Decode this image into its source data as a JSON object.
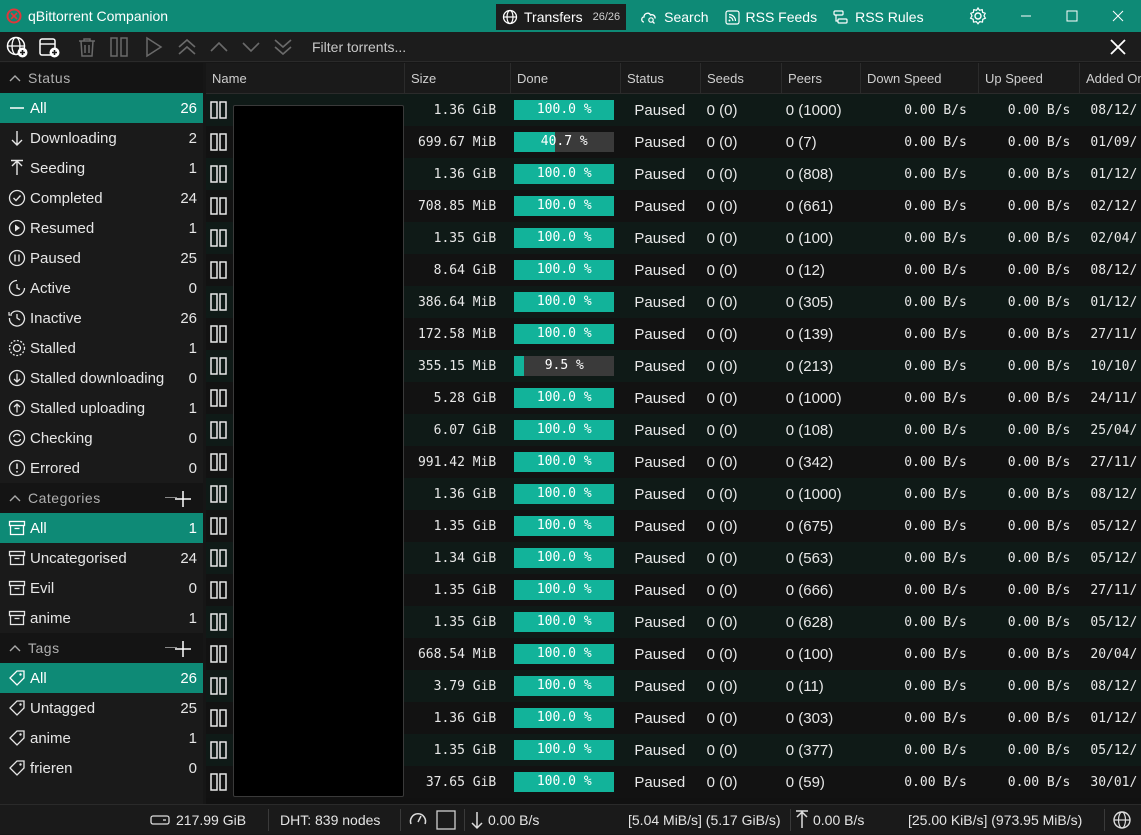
{
  "window": {
    "title": "qBittorrent Companion"
  },
  "nav": {
    "transfers": {
      "label": "Transfers",
      "count": "26/26"
    },
    "search": {
      "label": "Search"
    },
    "rss_feeds": {
      "label": "RSS Feeds"
    },
    "rss_rules": {
      "label": "RSS Rules"
    }
  },
  "toolbar": {
    "filter_placeholder": "Filter torrents..."
  },
  "sidebar": {
    "status_header": "Status",
    "status": [
      {
        "label": "All",
        "count": "26",
        "icon": "line-icon"
      },
      {
        "label": "Downloading",
        "count": "2",
        "icon": "arrow-down-icon"
      },
      {
        "label": "Seeding",
        "count": "1",
        "icon": "arrow-up-icon"
      },
      {
        "label": "Completed",
        "count": "24",
        "icon": "check-circle-icon"
      },
      {
        "label": "Resumed",
        "count": "1",
        "icon": "play-circle-icon"
      },
      {
        "label": "Paused",
        "count": "25",
        "icon": "pause-circle-icon"
      },
      {
        "label": "Active",
        "count": "0",
        "icon": "clock-icon"
      },
      {
        "label": "Inactive",
        "count": "26",
        "icon": "history-icon"
      },
      {
        "label": "Stalled",
        "count": "1",
        "icon": "stalled-icon"
      },
      {
        "label": "Stalled downloading",
        "count": "0",
        "icon": "arrow-down-circle-icon"
      },
      {
        "label": "Stalled uploading",
        "count": "1",
        "icon": "arrow-up-circle-icon"
      },
      {
        "label": "Checking",
        "count": "0",
        "icon": "refresh-circle-icon"
      },
      {
        "label": "Errored",
        "count": "0",
        "icon": "error-circle-icon"
      }
    ],
    "categories_header": "Categories",
    "categories": [
      {
        "label": "All",
        "count": "1"
      },
      {
        "label": "Uncategorised",
        "count": "24"
      },
      {
        "label": "Evil",
        "count": "0"
      },
      {
        "label": "anime",
        "count": "1"
      }
    ],
    "tags_header": "Tags",
    "tags": [
      {
        "label": "All",
        "count": "26"
      },
      {
        "label": "Untagged",
        "count": "25"
      },
      {
        "label": "anime",
        "count": "1"
      },
      {
        "label": "frieren",
        "count": "0"
      }
    ]
  },
  "table": {
    "columns": [
      "Name",
      "Size",
      "Done",
      "Status",
      "Seeds",
      "Peers",
      "Down Speed",
      "Up Speed",
      "Added On"
    ],
    "rows": [
      {
        "size": "1.36 GiB",
        "done": "100.0 %",
        "progress": 100,
        "status": "Paused",
        "seeds": "0 (0)",
        "peers": "0 (1000)",
        "down": "0.00 B/s",
        "up": "0.00 B/s",
        "added": "08/12/"
      },
      {
        "size": "699.67 MiB",
        "done": "40.7 %",
        "progress": 40.7,
        "status": "Paused",
        "seeds": "0 (0)",
        "peers": "0 (7)",
        "down": "0.00 B/s",
        "up": "0.00 B/s",
        "added": "01/09/"
      },
      {
        "size": "1.36 GiB",
        "done": "100.0 %",
        "progress": 100,
        "status": "Paused",
        "seeds": "0 (0)",
        "peers": "0 (808)",
        "down": "0.00 B/s",
        "up": "0.00 B/s",
        "added": "01/12/"
      },
      {
        "size": "708.85 MiB",
        "done": "100.0 %",
        "progress": 100,
        "status": "Paused",
        "seeds": "0 (0)",
        "peers": "0 (661)",
        "down": "0.00 B/s",
        "up": "0.00 B/s",
        "added": "02/12/"
      },
      {
        "size": "1.35 GiB",
        "done": "100.0 %",
        "progress": 100,
        "status": "Paused",
        "seeds": "0 (0)",
        "peers": "0 (100)",
        "down": "0.00 B/s",
        "up": "0.00 B/s",
        "added": "02/04/"
      },
      {
        "size": "8.64 GiB",
        "done": "100.0 %",
        "progress": 100,
        "status": "Paused",
        "seeds": "0 (0)",
        "peers": "0 (12)",
        "down": "0.00 B/s",
        "up": "0.00 B/s",
        "added": "08/12/"
      },
      {
        "size": "386.64 MiB",
        "done": "100.0 %",
        "progress": 100,
        "status": "Paused",
        "seeds": "0 (0)",
        "peers": "0 (305)",
        "down": "0.00 B/s",
        "up": "0.00 B/s",
        "added": "01/12/"
      },
      {
        "size": "172.58 MiB",
        "done": "100.0 %",
        "progress": 100,
        "status": "Paused",
        "seeds": "0 (0)",
        "peers": "0 (139)",
        "down": "0.00 B/s",
        "up": "0.00 B/s",
        "added": "27/11/"
      },
      {
        "size": "355.15 MiB",
        "done": "9.5 %",
        "progress": 9.5,
        "status": "Paused",
        "seeds": "0 (0)",
        "peers": "0 (213)",
        "down": "0.00 B/s",
        "up": "0.00 B/s",
        "added": "10/10/"
      },
      {
        "size": "5.28 GiB",
        "done": "100.0 %",
        "progress": 100,
        "status": "Paused",
        "seeds": "0 (0)",
        "peers": "0 (1000)",
        "down": "0.00 B/s",
        "up": "0.00 B/s",
        "added": "24/11/"
      },
      {
        "size": "6.07 GiB",
        "done": "100.0 %",
        "progress": 100,
        "status": "Paused",
        "seeds": "0 (0)",
        "peers": "0 (108)",
        "down": "0.00 B/s",
        "up": "0.00 B/s",
        "added": "25/04/"
      },
      {
        "size": "991.42 MiB",
        "done": "100.0 %",
        "progress": 100,
        "status": "Paused",
        "seeds": "0 (0)",
        "peers": "0 (342)",
        "down": "0.00 B/s",
        "up": "0.00 B/s",
        "added": "27/11/"
      },
      {
        "size": "1.36 GiB",
        "done": "100.0 %",
        "progress": 100,
        "status": "Paused",
        "seeds": "0 (0)",
        "peers": "0 (1000)",
        "down": "0.00 B/s",
        "up": "0.00 B/s",
        "added": "08/12/"
      },
      {
        "size": "1.35 GiB",
        "done": "100.0 %",
        "progress": 100,
        "status": "Paused",
        "seeds": "0 (0)",
        "peers": "0 (675)",
        "down": "0.00 B/s",
        "up": "0.00 B/s",
        "added": "05/12/"
      },
      {
        "size": "1.34 GiB",
        "done": "100.0 %",
        "progress": 100,
        "status": "Paused",
        "seeds": "0 (0)",
        "peers": "0 (563)",
        "down": "0.00 B/s",
        "up": "0.00 B/s",
        "added": "05/12/"
      },
      {
        "size": "1.35 GiB",
        "done": "100.0 %",
        "progress": 100,
        "status": "Paused",
        "seeds": "0 (0)",
        "peers": "0 (666)",
        "down": "0.00 B/s",
        "up": "0.00 B/s",
        "added": "27/11/"
      },
      {
        "size": "1.35 GiB",
        "done": "100.0 %",
        "progress": 100,
        "status": "Paused",
        "seeds": "0 (0)",
        "peers": "0 (628)",
        "down": "0.00 B/s",
        "up": "0.00 B/s",
        "added": "05/12/"
      },
      {
        "size": "668.54 MiB",
        "done": "100.0 %",
        "progress": 100,
        "status": "Paused",
        "seeds": "0 (0)",
        "peers": "0 (100)",
        "down": "0.00 B/s",
        "up": "0.00 B/s",
        "added": "20/04/"
      },
      {
        "size": "3.79 GiB",
        "done": "100.0 %",
        "progress": 100,
        "status": "Paused",
        "seeds": "0 (0)",
        "peers": "0 (11)",
        "down": "0.00 B/s",
        "up": "0.00 B/s",
        "added": "08/12/"
      },
      {
        "size": "1.36 GiB",
        "done": "100.0 %",
        "progress": 100,
        "status": "Paused",
        "seeds": "0 (0)",
        "peers": "0 (303)",
        "down": "0.00 B/s",
        "up": "0.00 B/s",
        "added": "01/12/"
      },
      {
        "size": "1.35 GiB",
        "done": "100.0 %",
        "progress": 100,
        "status": "Paused",
        "seeds": "0 (0)",
        "peers": "0 (377)",
        "down": "0.00 B/s",
        "up": "0.00 B/s",
        "added": "05/12/"
      },
      {
        "size": "37.65 GiB",
        "done": "100.0 %",
        "progress": 100,
        "status": "Paused",
        "seeds": "0 (0)",
        "peers": "0 (59)",
        "down": "0.00 B/s",
        "up": "0.00 B/s",
        "added": "30/01/"
      }
    ]
  },
  "statusbar": {
    "free_space": "217.99 GiB",
    "dht": "DHT: 839 nodes",
    "down_speed": "0.00 B/s",
    "down_total": "[5.04 MiB/s] (5.17 GiB/s)",
    "up_speed": "0.00 B/s",
    "up_total": "[25.00 KiB/s] (973.95 MiB/s)"
  },
  "colors": {
    "accent": "#0e8a76",
    "progress": "#12b39a",
    "background": "#161616"
  }
}
